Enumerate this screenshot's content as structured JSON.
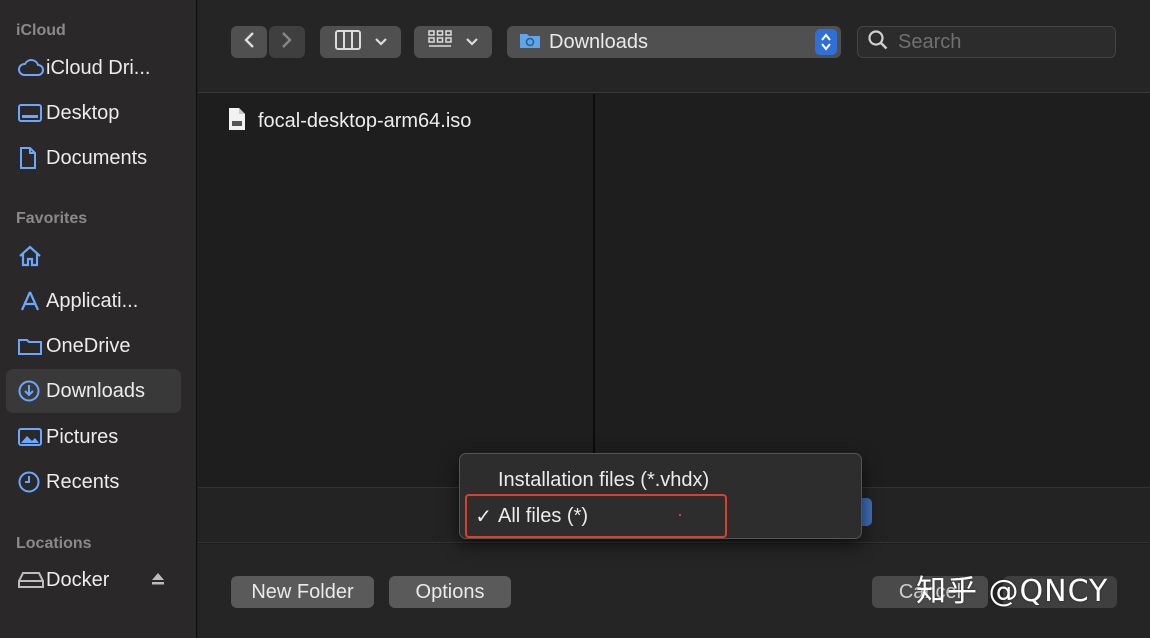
{
  "sidebar": {
    "icloud_label": "iCloud",
    "icloud_items": [
      {
        "label": "iCloud Dri...",
        "icon": "cloud-icon"
      },
      {
        "label": "Desktop",
        "icon": "desktop-icon"
      },
      {
        "label": "Documents",
        "icon": "document-icon"
      }
    ],
    "favorites_label": "Favorites",
    "favorites_items": [
      {
        "label": "",
        "icon": "home-icon"
      },
      {
        "label": "Applicati...",
        "icon": "applications-icon"
      },
      {
        "label": "OneDrive",
        "icon": "folder-icon"
      },
      {
        "label": "Downloads",
        "icon": "downloads-icon",
        "selected": true
      },
      {
        "label": "Pictures",
        "icon": "pictures-icon"
      },
      {
        "label": "Recents",
        "icon": "clock-icon"
      }
    ],
    "locations_label": "Locations",
    "locations_items": [
      {
        "label": "Docker",
        "icon": "drive-icon"
      }
    ]
  },
  "toolbar": {
    "location": "Downloads",
    "search_placeholder": "Search"
  },
  "files": [
    {
      "name": "focal-desktop-arm64.iso",
      "icon": "file-icon"
    }
  ],
  "file_type_menu": {
    "options": [
      {
        "label": "Installation files (*.vhdx)",
        "checked": false
      },
      {
        "label": "All files (*)",
        "checked": true
      }
    ]
  },
  "buttons": {
    "new_folder": "New Folder",
    "options": "Options",
    "cancel": "Cancel"
  },
  "watermark": "知乎 @QNCY",
  "colors": {
    "accent": "#2f6fd8",
    "highlight_border": "#d9412c",
    "sidebar_bg": "#2a2829"
  }
}
